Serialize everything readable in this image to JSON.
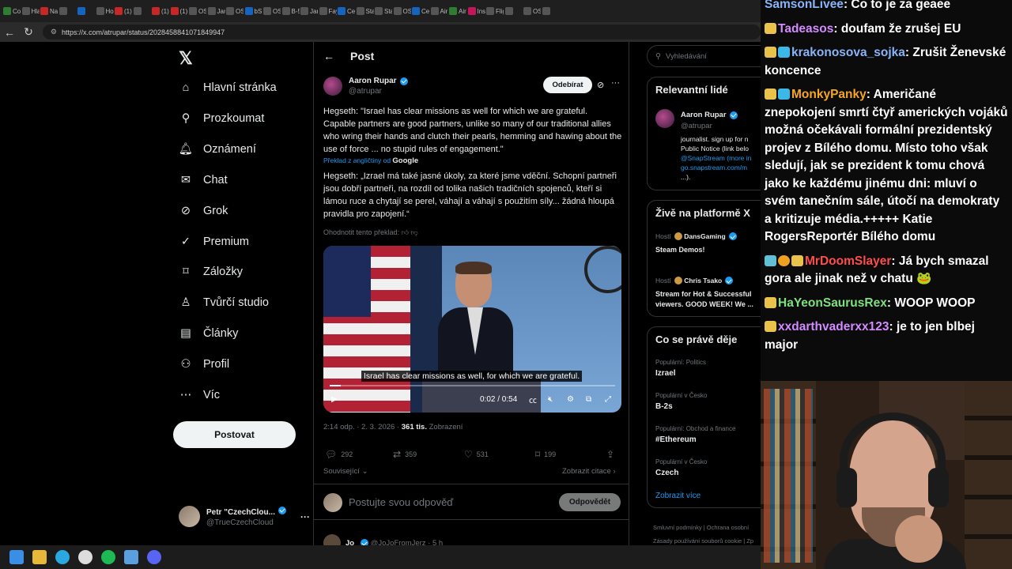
{
  "browser": {
    "tabs": [
      "Co",
      "Hla",
      "Na",
      "",
      "",
      "Ho",
      "(1)",
      "",
      "(1)",
      "(1)",
      "OS",
      "Jan",
      "OS",
      "bS",
      "OS",
      "B-5",
      "Jan",
      "Fay",
      "Ce",
      "Sta",
      "Sta",
      "OS",
      "Ce",
      "Air",
      "Air",
      "Ins",
      "Flig",
      "",
      "OS",
      ""
    ],
    "url": "https://x.com/atrupar/status/2028458841071849947"
  },
  "nav": {
    "items": [
      {
        "label": "Hlavní stránka",
        "icon": "home-icon",
        "glyph": "⌂"
      },
      {
        "label": "Prozkoumat",
        "icon": "search-icon",
        "glyph": "⚲"
      },
      {
        "label": "Oznámení",
        "icon": "bell-icon",
        "glyph": "🔔︎"
      },
      {
        "label": "Chat",
        "icon": "mail-icon",
        "glyph": "✉"
      },
      {
        "label": "Grok",
        "icon": "grok-icon",
        "glyph": "⊘"
      },
      {
        "label": "Premium",
        "icon": "premium-icon",
        "glyph": "✓"
      },
      {
        "label": "Záložky",
        "icon": "bookmark-icon",
        "glyph": "⌑"
      },
      {
        "label": "Tvůrčí studio",
        "icon": "creator-icon",
        "glyph": "♙"
      },
      {
        "label": "Články",
        "icon": "article-icon",
        "glyph": "▤"
      },
      {
        "label": "Profil",
        "icon": "profile-icon",
        "glyph": "⚇"
      },
      {
        "label": "Víc",
        "icon": "more-icon",
        "glyph": "⋯"
      }
    ],
    "post_button": "Postovat",
    "me": {
      "name": "Petr \"CzechClou...",
      "handle": "@TrueCzechCloud"
    }
  },
  "post": {
    "header": "Post",
    "author_name": "Aaron Rupar",
    "author_handle": "@atrupar",
    "follow_label": "Odebírat",
    "text_original": "Hegseth: \"Israel has clear missions as well for which we are grateful. Capable partners are good partners, unlike so many of our traditional allies who wring their hands and clutch their pearls, hemming and hawing about the use of force ... no stupid rules of engagement.\"",
    "translation_note": "Překlad z angličtiny od",
    "translation_provider": "Google",
    "text_translated": "Hegseth: „Izrael má také jasné úkoly, za které jsme vděční. Schopní partneři jsou dobří partneři, na rozdíl od tolika našich tradičních spojenců, kteří si lámou ruce a chytají se perel, váhají a váhají s použitím síly... žádná hloupá pravidla pro zapojení.“",
    "rate_translation": "Ohodnotit tento překlad:",
    "video": {
      "caption": "Israel has clear missions as well, for which we are grateful.",
      "time": "0:02 / 0:54",
      "progress": 0.04
    },
    "time": "2:14 odp. · 2. 3. 2026 ·",
    "views": "361 tis.",
    "views_label": "Zobrazení",
    "replies": "292",
    "reposts": "359",
    "likes": "531",
    "bookmarks": "199",
    "related": "Související",
    "quotes": "Zobrazit citace",
    "reply_placeholder": "Postujte svou odpověď",
    "reply_button": "Odpovědět",
    "next_reply_name": "Jo",
    "next_reply_handle": "@JoJoFromJerz · 5 h"
  },
  "right": {
    "search_placeholder": "Vyhledávání",
    "relevant_title": "Relevantní lidé",
    "relevant_person": {
      "name": "Aaron Rupar",
      "handle": "@atrupar",
      "bio1": "journalist. sign up for n",
      "bio2": "Public Notice (link belo",
      "bio3": "@SnapStream (more in",
      "bio4": "go.snapstream.com/m",
      "bio5": "...)."
    },
    "live_title": "Živě na platformě X",
    "live": [
      {
        "host_label": "Hostí",
        "host": "DansGaming",
        "title": "Steam Demos!"
      },
      {
        "host_label": "Hostí",
        "host": "Chris Tsako",
        "title": "Stream for Hot & Successful viewers. GOOD WEEK! We ..."
      }
    ],
    "trends_title": "Co se právě děje",
    "trends": [
      {
        "context": "Populární: Politics",
        "topic": "Izrael"
      },
      {
        "context": "Populární v Česko",
        "topic": "B-2s"
      },
      {
        "context": "Populární: Obchod a finance",
        "topic": "#Ethereum"
      },
      {
        "context": "Populární v Česko",
        "topic": "Czech"
      }
    ],
    "show_more": "Zobrazit více",
    "footer1": "Smluvní podmínky  |  Ochrana osobní",
    "footer2": "Zásady používání souborů cookie  |  Zp"
  },
  "chat": [
    {
      "user": "SamsonLivee",
      "color": "#8ab4f8",
      "text": "Co to je za geaee",
      "badges": []
    },
    {
      "user": "Tadeasos",
      "color": "#d38bff",
      "text": "doufam že zrušej EU",
      "badges": [
        "b-gold"
      ]
    },
    {
      "user": "krakonosova_sojka",
      "color": "#8ab4f8",
      "text": "Zrušit Ženevské koncence",
      "badges": [
        "b-gold",
        "b-cyan"
      ]
    },
    {
      "user": "MonkyPanky",
      "color": "#f5a623",
      "text": "Američané znepokojení smrtí čtyř amerických vojáků možná očekávali formální prezidentský projev z Bílého domu. Místo toho však sledují, jak se prezident k tomu chová jako ke každému jinému dni: mluví o svém tanečním sále, útočí na demokraty a kritizuje média.+++++ Katie RogersReportér Bílého domu",
      "badges": [
        "b-gold",
        "b-cyan"
      ]
    },
    {
      "user": "MrDoomSlayer",
      "color": "#ff4d4d",
      "text": "Já bych smazal gora ale jinak než v chatu 🐸",
      "badges": [
        "b-grid",
        "b-orange",
        "b-gold"
      ]
    },
    {
      "user": "HaYeonSaurusRex",
      "color": "#7ee07e",
      "text": "WOOP WOOP",
      "badges": [
        "b-gold"
      ]
    },
    {
      "user": "xxdarthvaderxx123",
      "color": "#d38bff",
      "text": "je to jen blbej major",
      "badges": [
        "b-gold"
      ]
    }
  ]
}
